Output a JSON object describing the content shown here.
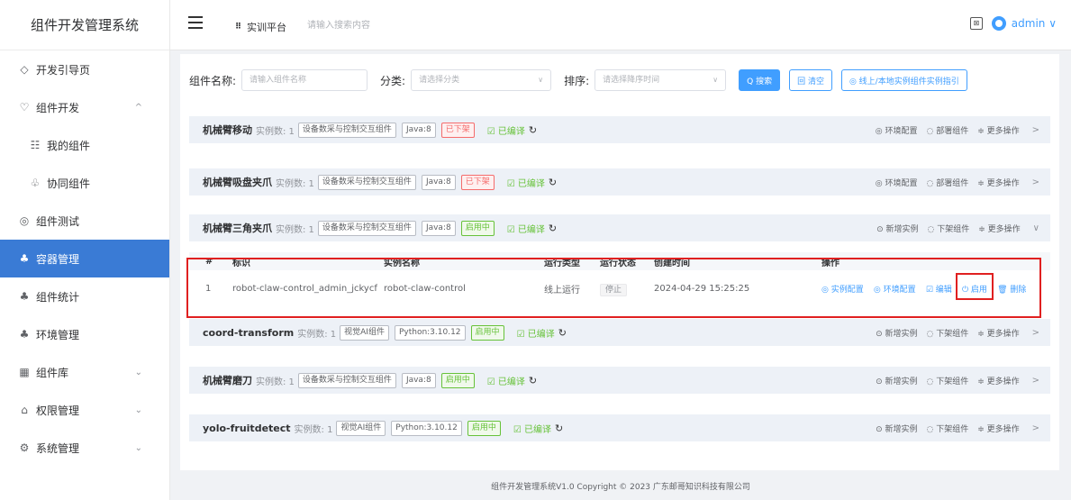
{
  "app_title": "组件开发管理系统",
  "sidebar": {
    "items": [
      {
        "icon": "◇",
        "label": "开发引导页",
        "sub": false,
        "arrow": ""
      },
      {
        "icon": "♡",
        "label": "组件开发",
        "sub": false,
        "arrow": "^"
      },
      {
        "icon": "☷",
        "label": "我的组件",
        "sub": true,
        "arrow": ""
      },
      {
        "icon": "♧",
        "label": "协同组件",
        "sub": true,
        "arrow": ""
      },
      {
        "icon": "◎",
        "label": "组件测试",
        "sub": false,
        "arrow": ""
      },
      {
        "icon": "♣",
        "label": "容器管理",
        "sub": false,
        "arrow": "",
        "active": true
      },
      {
        "icon": "♣",
        "label": "组件统计",
        "sub": false,
        "arrow": ""
      },
      {
        "icon": "♣",
        "label": "环境管理",
        "sub": false,
        "arrow": ""
      },
      {
        "icon": "▦",
        "label": "组件库",
        "sub": false,
        "arrow": "⌄"
      },
      {
        "icon": "⌂",
        "label": "权限管理",
        "sub": false,
        "arrow": "⌄"
      },
      {
        "icon": "⚙",
        "label": "系统管理",
        "sub": false,
        "arrow": "⌄"
      }
    ]
  },
  "header": {
    "platform_icon": "⠿",
    "platform": "实训平台",
    "search_placeholder": "请输入搜索内容",
    "user": "admin ∨"
  },
  "filter": {
    "name_label": "组件名称:",
    "name_placeholder": "请输入组件名称",
    "category_label": "分类:",
    "category_placeholder": "请选择分类",
    "sort_label": "排序:",
    "sort_placeholder": "请选择降序时间",
    "search_button": "Q 搜索",
    "clear_button": "回 清空",
    "guide_button": "◎ 线上/本地实例组件实例指引"
  },
  "components": [
    {
      "name": "机械臂移动",
      "instances": "实例数: 1",
      "tag1": "设备数采与控制交互组件",
      "tag2": "Java:8",
      "status": "已下架",
      "status_color": "red",
      "compiled": "☑ 已编译",
      "actions": [
        "◎ 环境配置",
        "◌ 部署组件",
        "≑ 更多操作"
      ],
      "chev": ">"
    },
    {
      "name": "机械臂吸盘夹爪",
      "instances": "实例数: 1",
      "tag1": "设备数采与控制交互组件",
      "tag2": "Java:8",
      "status": "已下架",
      "status_color": "red",
      "compiled": "☑ 已编译",
      "actions": [
        "◎ 环境配置",
        "◌ 部署组件",
        "≑ 更多操作"
      ],
      "chev": ">"
    },
    {
      "name": "机械臂三角夹爪",
      "instances": "实例数: 1",
      "tag1": "设备数采与控制交互组件",
      "tag2": "Java:8",
      "status": "启用中",
      "status_color": "green",
      "compiled": "☑ 已编译",
      "actions": [
        "⊙ 新增实例",
        "◌ 下架组件",
        "≑ 更多操作"
      ],
      "chev": "∨"
    },
    {
      "name": "coord-transform",
      "instances": "实例数: 1",
      "tag1": "视觉AI组件",
      "tag2": "Python:3.10.12",
      "status": "启用中",
      "status_color": "green",
      "compiled": "☑ 已编译",
      "actions": [
        "⊙ 新增实例",
        "◌ 下架组件",
        "≑ 更多操作"
      ],
      "chev": ">"
    },
    {
      "name": "机械臂磨刀",
      "instances": "实例数: 1",
      "tag1": "设备数采与控制交互组件",
      "tag2": "Java:8",
      "status": "启用中",
      "status_color": "green",
      "compiled": "☑ 已编译",
      "actions": [
        "⊙ 新增实例",
        "◌ 下架组件",
        "≑ 更多操作"
      ],
      "chev": ">"
    },
    {
      "name": "yolo-fruitdetect",
      "instances": "实例数: 1",
      "tag1": "视觉AI组件",
      "tag2": "Python:3.10.12",
      "status": "启用中",
      "status_color": "green",
      "compiled": "☑ 已编译",
      "actions": [
        "⊙ 新增实例",
        "◌ 下架组件",
        "≑ 更多操作"
      ],
      "chev": ">"
    }
  ],
  "instance_table": {
    "headers": [
      "#",
      "标识",
      "实例名称",
      "运行类型",
      "运行状态",
      "创建时间",
      "操作"
    ],
    "row": {
      "index": "1",
      "id": "robot-claw-control_admin_jckycf",
      "name": "robot-claw-control",
      "run_type": "线上运行",
      "run_status": "停止",
      "created": "2024-04-29 15:25:25",
      "ops": [
        "◎ 实例配置",
        "◎ 环境配置",
        "☑ 编辑",
        "⏻ 启用",
        "🗑 删除"
      ]
    }
  },
  "footer": "组件开发管理系统V1.0 Copyright © 2023 广东邮哥知识科技有限公司",
  "colors": {
    "primary": "#409eff",
    "active_sidebar": "#3a7bd5",
    "highlight": "#e02020"
  }
}
